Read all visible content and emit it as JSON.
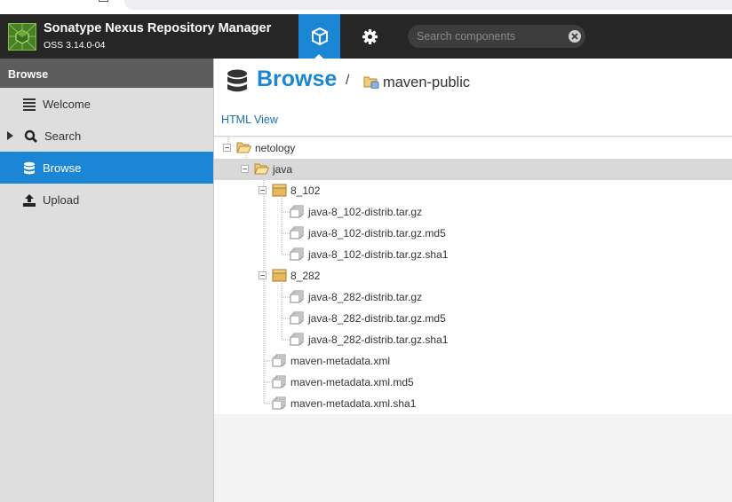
{
  "app": {
    "title": "Sonatype Nexus Repository Manager",
    "version": "OSS 3.14.0-04"
  },
  "header": {
    "nav": [
      {
        "name": "browse",
        "icon": "cube-icon",
        "active": true
      },
      {
        "name": "administration",
        "icon": "gear-icon",
        "active": false
      }
    ],
    "search": {
      "placeholder": "Search components"
    }
  },
  "sidebar": {
    "title": "Browse",
    "items": [
      {
        "label": "Welcome",
        "icon": "list-icon"
      },
      {
        "label": "Search",
        "icon": "magnifier-icon",
        "expandable": true
      },
      {
        "label": "Browse",
        "icon": "database-icon",
        "selected": true
      },
      {
        "label": "Upload",
        "icon": "upload-icon"
      }
    ]
  },
  "main": {
    "breadcrumb_title": "Browse",
    "breadcrumb_separator": "/",
    "repository": "maven-public",
    "html_view_link": "HTML View"
  },
  "tree": {
    "nodes": [
      {
        "label": "netology",
        "type": "folder-open",
        "level": 0,
        "toggle": true
      },
      {
        "label": "java",
        "type": "folder-open",
        "level": 1,
        "toggle": true,
        "selected": true
      },
      {
        "label": "8_102",
        "type": "package",
        "level": 2,
        "toggle": true
      },
      {
        "label": "java-8_102-distrib.tar.gz",
        "type": "file",
        "level": 3
      },
      {
        "label": "java-8_102-distrib.tar.gz.md5",
        "type": "file",
        "level": 3
      },
      {
        "label": "java-8_102-distrib.tar.gz.sha1",
        "type": "file",
        "level": 3
      },
      {
        "label": "8_282",
        "type": "package",
        "level": 2,
        "toggle": true
      },
      {
        "label": "java-8_282-distrib.tar.gz",
        "type": "file",
        "level": 3
      },
      {
        "label": "java-8_282-distrib.tar.gz.md5",
        "type": "file",
        "level": 3
      },
      {
        "label": "java-8_282-distrib.tar.gz.sha1",
        "type": "file",
        "level": 3
      },
      {
        "label": "maven-metadata.xml",
        "type": "file",
        "level": 2
      },
      {
        "label": "maven-metadata.xml.md5",
        "type": "file",
        "level": 2
      },
      {
        "label": "maven-metadata.xml.sha1",
        "type": "file",
        "level": 2
      }
    ]
  },
  "colors": {
    "accent": "#1b86d3",
    "header_bg": "#262626",
    "sidebar_bg": "#dedede",
    "sidebar_header_bg": "#5c5c5c",
    "selected_row": "#d9d9d9",
    "folder": "#f5c97a",
    "package": "#e8b95a"
  }
}
